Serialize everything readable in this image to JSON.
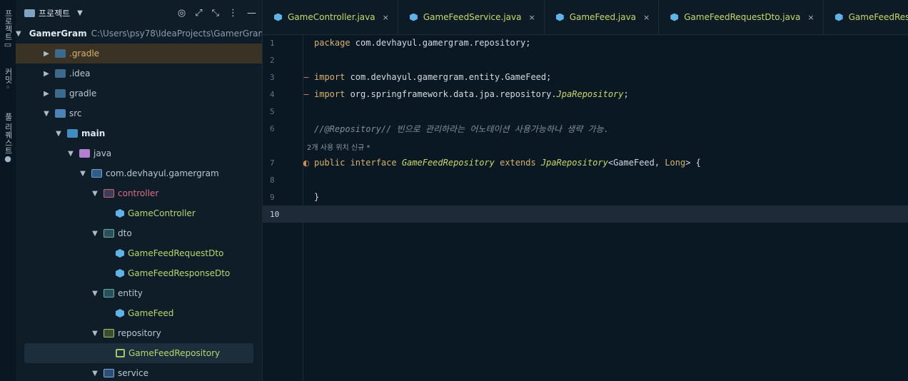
{
  "strip": [
    {
      "icon": "folder-icon",
      "label": "프로젝트"
    },
    {
      "icon": "commit-icon",
      "label": "커밋"
    },
    {
      "icon": "github-icon",
      "label": "풀 리퀘스트"
    }
  ],
  "panel": {
    "title": "프로젝트",
    "tools": [
      "target-icon",
      "expand-icon",
      "collapse-icon",
      "more-icon",
      "minimize-icon"
    ]
  },
  "tree": [
    {
      "label": "GamerGram",
      "path": "C:\\Users\\psy78\\IdeaProjects\\GamerGram",
      "indent": 0,
      "arrow": "▼",
      "icon": "folder",
      "bold": true
    },
    {
      "label": ".gradle",
      "indent": 1,
      "arrow": "▶",
      "icon": "folder dark",
      "hl": true,
      "style": "gold"
    },
    {
      "label": ".idea",
      "indent": 1,
      "arrow": "▶",
      "icon": "folder dark"
    },
    {
      "label": "gradle",
      "indent": 1,
      "arrow": "▶",
      "icon": "folder dark"
    },
    {
      "label": "src",
      "indent": 1,
      "arrow": "▼",
      "icon": "folder src"
    },
    {
      "label": "main",
      "indent": 2,
      "arrow": "▼",
      "icon": "folder main",
      "bold": true
    },
    {
      "label": "java",
      "indent": 3,
      "arrow": "▼",
      "icon": "folder java"
    },
    {
      "label": "com.devhayul.gamergram",
      "indent": 4,
      "arrow": "▼",
      "icon": "folder pkg"
    },
    {
      "label": "controller",
      "indent": 5,
      "arrow": "▼",
      "icon": "folder ctrl",
      "style": "red"
    },
    {
      "label": "GameController",
      "indent": 6,
      "arrow": "",
      "icon": "cls",
      "style": "green"
    },
    {
      "label": "dto",
      "indent": 5,
      "arrow": "▼",
      "icon": "folder dto"
    },
    {
      "label": "GameFeedRequestDto",
      "indent": 6,
      "arrow": "",
      "icon": "cls",
      "style": "green"
    },
    {
      "label": "GameFeedResponseDto",
      "indent": 6,
      "arrow": "",
      "icon": "cls",
      "style": "green"
    },
    {
      "label": "entity",
      "indent": 5,
      "arrow": "▼",
      "icon": "folder dto"
    },
    {
      "label": "GameFeed",
      "indent": 6,
      "arrow": "",
      "icon": "cls",
      "style": "green"
    },
    {
      "label": "repository",
      "indent": 5,
      "arrow": "▼",
      "icon": "folder repo"
    },
    {
      "label": "GameFeedRepository",
      "indent": 6,
      "arrow": "",
      "icon": "ifc",
      "style": "green",
      "sel": true
    },
    {
      "label": "service",
      "indent": 5,
      "arrow": "▼",
      "icon": "folder svc"
    }
  ],
  "tabs": [
    {
      "name": "GameController.java",
      "close": "×"
    },
    {
      "name": "GameFeedService.java",
      "close": "×"
    },
    {
      "name": "GameFeed.java",
      "close": "×"
    },
    {
      "name": "GameFeedRequestDto.java",
      "close": "×"
    },
    {
      "name": "GameFeedResponseDto.java",
      "close": ""
    }
  ],
  "lines": [
    {
      "n": "1",
      "html": "<span class='kw'>package</span> com.devhayul.gamergram.repository;"
    },
    {
      "n": "2",
      "html": ""
    },
    {
      "n": "3",
      "html": "<span class='kw'>import</span> com.devhayul.gamergram.entity.GameFeed;",
      "fold": true
    },
    {
      "n": "4",
      "html": "<span class='kw'>import</span> org.springframework.data.jpa.repository.<span class='fn'>JpaRepository</span>;",
      "fold": true
    },
    {
      "n": "5",
      "html": ""
    },
    {
      "n": "6",
      "html": "<span class='cm'>//@Repository// 빈으로 관리하라는 어노테이션 사용가능하나 생략 가능.</span>"
    },
    {
      "n": "7",
      "html": "<span class='kw'>public interface</span> <span class='fn'>GameFeedRepository</span> <span class='kw'>extends</span> <span class='fn'>JpaRepository</span>&lt;GameFeed, <span class='kw'>Long</span>&gt; {",
      "gutter": "usage-icon"
    },
    {
      "n": "8",
      "html": ""
    },
    {
      "n": "9",
      "html": "}"
    },
    {
      "n": "10",
      "html": "",
      "cur": true
    }
  ],
  "hint": "2개 사용 위치   신규 *"
}
